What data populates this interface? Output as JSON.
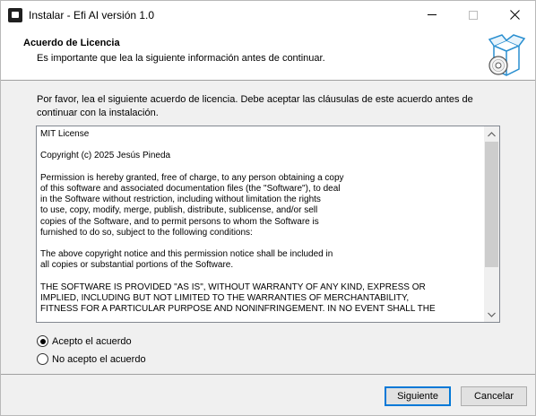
{
  "window": {
    "title": "Instalar - Efi AI versión 1.0",
    "controls": {
      "minimize": "minimize-icon",
      "maximize": "maximize-icon",
      "close": "close-icon"
    }
  },
  "header": {
    "title": "Acuerdo de Licencia",
    "subtitle": "Es importante que lea la siguiente información antes de continuar.",
    "image": "installer-box-cd-icon"
  },
  "intro": "Por favor, lea el siguiente acuerdo de licencia. Debe aceptar las cláusulas de este acuerdo antes de continuar con la instalación.",
  "license_text": "MIT License\n\nCopyright (c) 2025 Jesús Pineda\n\nPermission is hereby granted, free of charge, to any person obtaining a copy\nof this software and associated documentation files (the \"Software\"), to deal\nin the Software without restriction, including without limitation the rights\nto use, copy, modify, merge, publish, distribute, sublicense, and/or sell\ncopies of the Software, and to permit persons to whom the Software is\nfurnished to do so, subject to the following conditions:\n\nThe above copyright notice and this permission notice shall be included in\nall copies or substantial portions of the Software.\n\nTHE SOFTWARE IS PROVIDED \"AS IS\", WITHOUT WARRANTY OF ANY KIND, EXPRESS OR\nIMPLIED, INCLUDING BUT NOT LIMITED TO THE WARRANTIES OF MERCHANTABILITY,\nFITNESS FOR A PARTICULAR PURPOSE AND NONINFRINGEMENT. IN NO EVENT SHALL THE",
  "options": {
    "accept": {
      "label": "Acepto el acuerdo",
      "selected": true
    },
    "reject": {
      "label": "No acepto el acuerdo",
      "selected": false
    }
  },
  "buttons": {
    "next": "Siguiente",
    "cancel": "Cancelar"
  },
  "colors": {
    "focus_border": "#0078d7",
    "window_bg": "#f0f0f0"
  }
}
